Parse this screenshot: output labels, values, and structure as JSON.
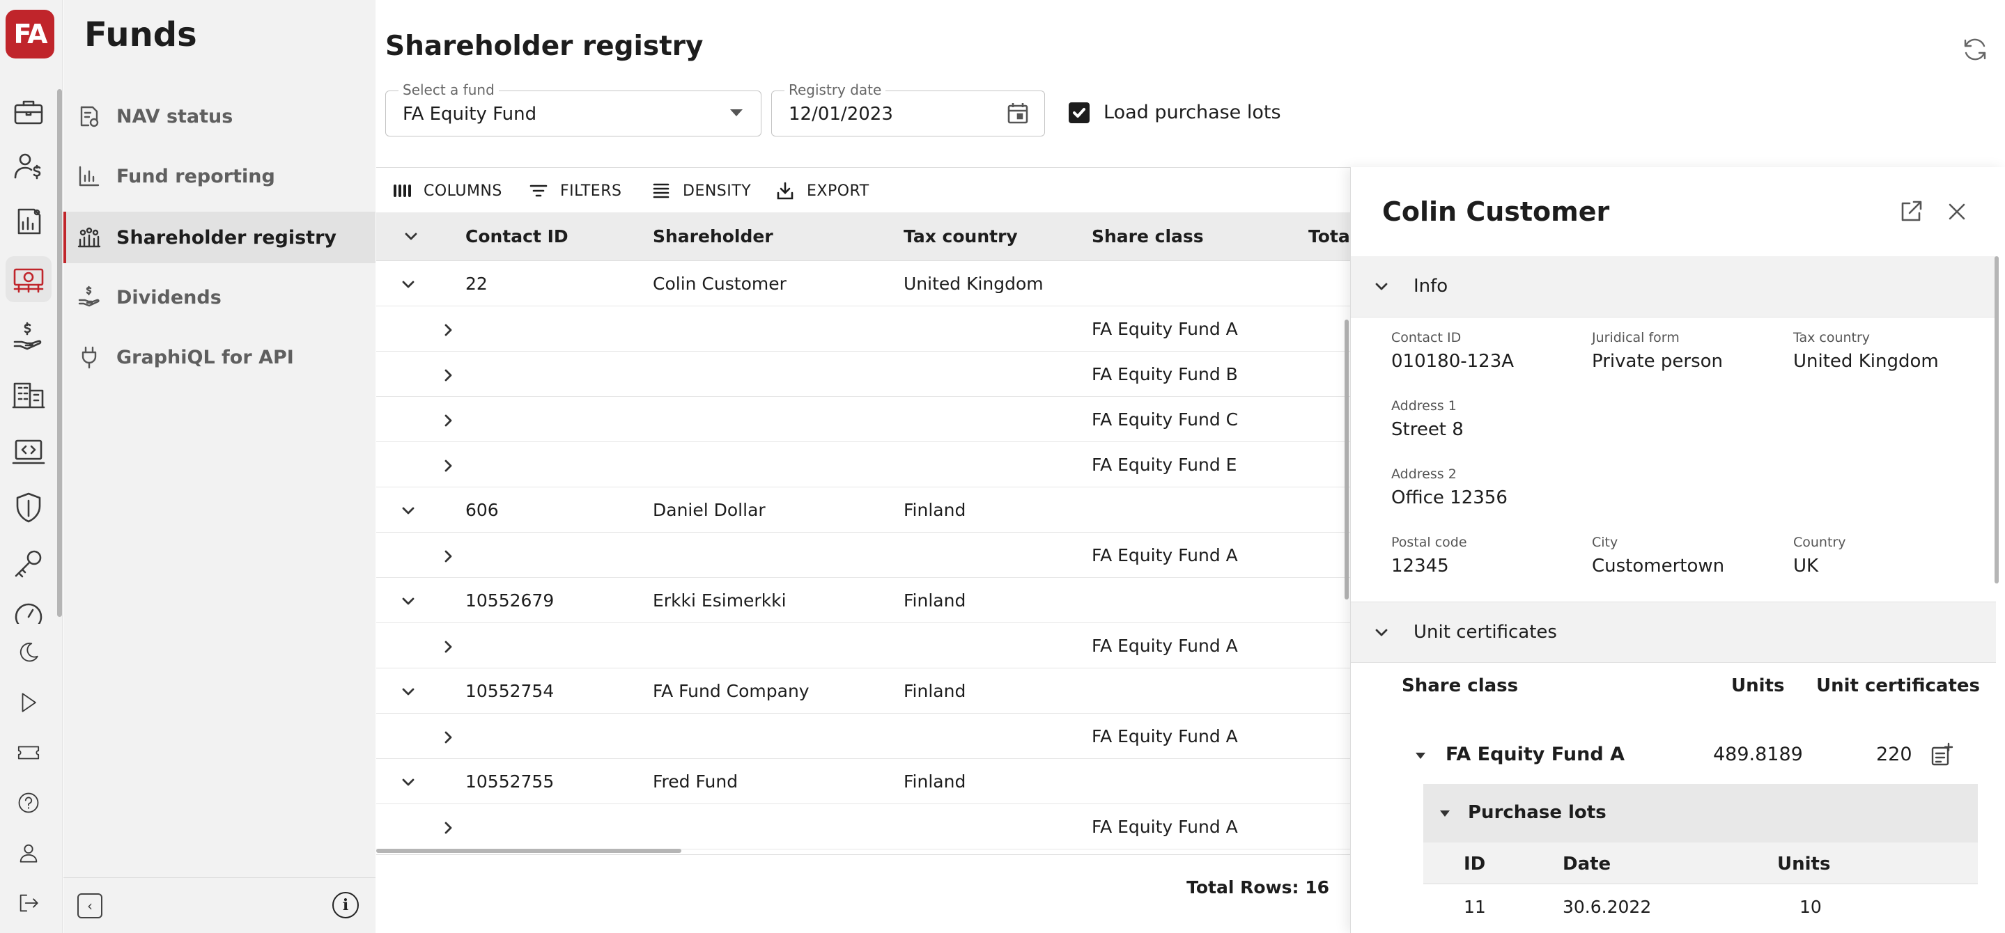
{
  "app": {
    "logo": "FA",
    "section_title": "Funds",
    "brand_color": "#c0252b"
  },
  "rail": {
    "icons": [
      "briefcase-icon",
      "contact-money-icon",
      "report-icon",
      "funds-icon",
      "payment-hand-icon",
      "building-icon",
      "code-screen-icon",
      "shield-icon",
      "key-icon",
      "gauge-icon",
      "moon-icon",
      "play-icon",
      "ticket-icon",
      "help-icon",
      "user-icon",
      "logout-icon"
    ]
  },
  "nav": {
    "items": [
      {
        "label": "NAV status",
        "icon": "nav-status-icon"
      },
      {
        "label": "Fund reporting",
        "icon": "chart-icon"
      },
      {
        "label": "Shareholder registry",
        "icon": "registry-icon",
        "active": true
      },
      {
        "label": "Dividends",
        "icon": "dividends-icon"
      },
      {
        "label": "GraphiQL for API",
        "icon": "plug-icon"
      }
    ]
  },
  "page": {
    "title": "Shareholder registry",
    "fund_select": {
      "label": "Select a fund",
      "value": "FA Equity Fund"
    },
    "registry_date": {
      "label": "Registry date",
      "value": "12/01/2023"
    },
    "load_purchase_lots": {
      "label": "Load purchase lots",
      "checked": true
    }
  },
  "grid": {
    "toolbar": {
      "columns": "COLUMNS",
      "filters": "FILTERS",
      "density": "DENSITY",
      "export": "EXPORT"
    },
    "columns": {
      "contact_id": "Contact ID",
      "shareholder": "Shareholder",
      "tax_country": "Tax country",
      "share_class": "Share class",
      "total": "Total"
    },
    "rows": [
      {
        "type": "group",
        "contact_id": "22",
        "shareholder": "Colin Customer",
        "tax_country": "United Kingdom"
      },
      {
        "type": "child",
        "share_class": "FA Equity Fund A"
      },
      {
        "type": "child",
        "share_class": "FA Equity Fund B"
      },
      {
        "type": "child",
        "share_class": "FA Equity Fund C"
      },
      {
        "type": "child",
        "share_class": "FA Equity Fund E"
      },
      {
        "type": "group",
        "contact_id": "606",
        "shareholder": "Daniel Dollar",
        "tax_country": "Finland"
      },
      {
        "type": "child",
        "share_class": "FA Equity Fund A"
      },
      {
        "type": "group",
        "contact_id": "10552679",
        "shareholder": "Erkki Esimerkki",
        "tax_country": "Finland"
      },
      {
        "type": "child",
        "share_class": "FA Equity Fund A"
      },
      {
        "type": "group",
        "contact_id": "10552754",
        "shareholder": "FA Fund Company",
        "tax_country": "Finland"
      },
      {
        "type": "child",
        "share_class": "FA Equity Fund A"
      },
      {
        "type": "group",
        "contact_id": "10552755",
        "shareholder": "Fred Fund",
        "tax_country": "Finland"
      },
      {
        "type": "child",
        "share_class": "FA Equity Fund A"
      }
    ],
    "total_rows": "Total Rows: 16"
  },
  "drawer": {
    "title": "Colin Customer",
    "info": {
      "header": "Info",
      "contact_id": {
        "label": "Contact ID",
        "value": "010180-123A"
      },
      "juridical_form": {
        "label": "Juridical form",
        "value": "Private person"
      },
      "tax_country": {
        "label": "Tax country",
        "value": "United Kingdom"
      },
      "address1": {
        "label": "Address 1",
        "value": "Street 8"
      },
      "address2": {
        "label": "Address 2",
        "value": "Office 12356"
      },
      "postal_code": {
        "label": "Postal code",
        "value": "12345"
      },
      "city": {
        "label": "City",
        "value": "Customertown"
      },
      "country": {
        "label": "Country",
        "value": "UK"
      }
    },
    "unit_certificates": {
      "header": "Unit certificates",
      "col_share_class": "Share class",
      "col_units": "Units",
      "col_certificates": "Unit certificates",
      "row": {
        "share_class": "FA Equity Fund A",
        "units": "489.8189",
        "certificates": "220"
      },
      "purchase_lots": {
        "header": "Purchase lots",
        "col_id": "ID",
        "col_date": "Date",
        "col_units": "Units",
        "row": {
          "id": "11",
          "date": "30.6.2022",
          "units": "10"
        }
      }
    }
  }
}
